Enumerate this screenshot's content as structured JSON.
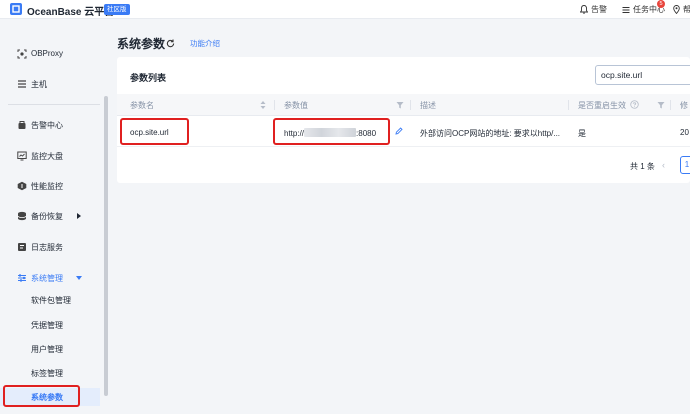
{
  "topbar": {
    "brand": "OceanBase 云平台",
    "edition": "社区版",
    "alerts_label": "告警",
    "tasks_label": "任务中心",
    "tasks_count": "5",
    "help_label": "帮"
  },
  "sidebar": {
    "items": [
      {
        "label": "OBProxy",
        "icon": "obproxy-icon"
      },
      {
        "label": "主机",
        "icon": "host-list-icon"
      },
      {
        "label": "告警中心",
        "icon": "alert-center-icon"
      },
      {
        "label": "监控大盘",
        "icon": "monitor-dashboard-icon"
      },
      {
        "label": "性能监控",
        "icon": "performance-icon"
      },
      {
        "label": "备份恢复",
        "icon": "backup-icon"
      },
      {
        "label": "日志服务",
        "icon": "log-service-icon"
      },
      {
        "label": "系统管理",
        "icon": "system-manage-icon"
      }
    ],
    "sub_items": [
      {
        "label": "软件包管理"
      },
      {
        "label": "凭据管理"
      },
      {
        "label": "用户管理"
      },
      {
        "label": "标签管理"
      },
      {
        "label": "系统参数"
      }
    ]
  },
  "main": {
    "title": "系统参数",
    "feature_link": "功能介绍",
    "card": {
      "title": "参数列表",
      "search": {
        "value": "ocp.site.url",
        "placeholder": ""
      },
      "columns": [
        "参数名",
        "参数值",
        "描述",
        "是否重启生效",
        "修"
      ],
      "rows": [
        {
          "name": "ocp.site.url",
          "value_prefix": "http://",
          "value_suffix": ":8080",
          "description": "外部访问OCP网站的地址: 要求以http/...",
          "restart": "是",
          "modified": "20"
        }
      ]
    },
    "pagination": {
      "total": "共 1 条",
      "prev": "‹",
      "page": "1"
    }
  },
  "colors": {
    "accent": "#3a7bf5",
    "highlight": "#e02020",
    "badge": "#e8453c"
  }
}
